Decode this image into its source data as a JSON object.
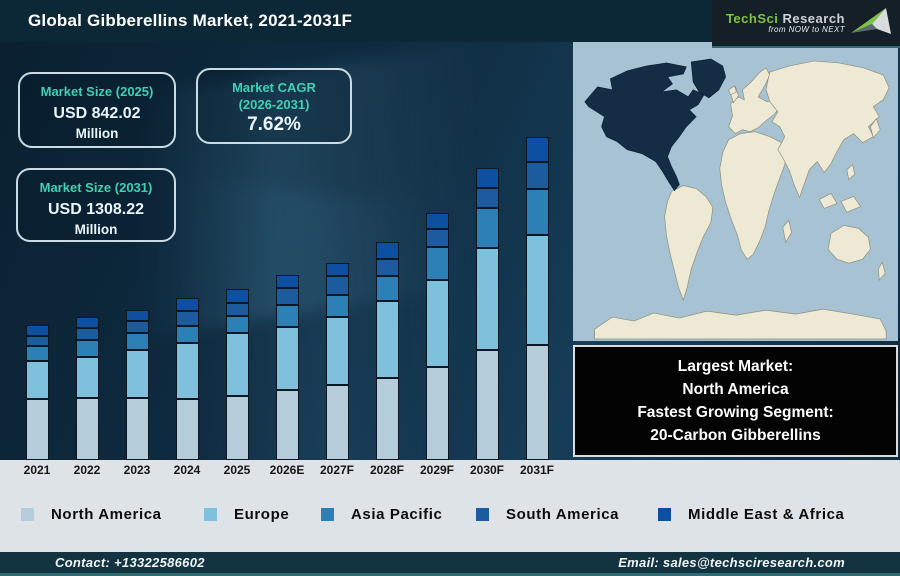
{
  "header": {
    "title": "Global Gibberellins Market, 2021-2031F",
    "logo": {
      "brand_primary": "TechSci",
      "brand_secondary": "Research",
      "tagline": "from NOW to NEXT"
    }
  },
  "stats": {
    "size_2025": {
      "label": "Market Size (2025)",
      "value": "USD 842.02",
      "unit": "Million"
    },
    "cagr": {
      "label_line1": "Market CAGR",
      "label_line2": "(2026-2031)",
      "value": "7.62%"
    },
    "size_2031": {
      "label": "Market Size (2031)",
      "value": "USD 1308.22",
      "unit": "Million"
    }
  },
  "highlight_box": {
    "line1": "Largest Market:",
    "line2": "North America",
    "line3": "Fastest Growing Segment:",
    "line4": "20-Carbon Gibberellins"
  },
  "legend": {
    "items": [
      {
        "label": "North America",
        "color": "#b5cdda"
      },
      {
        "label": "Europe",
        "color": "#7fc0dd"
      },
      {
        "label": "Asia Pacific",
        "color": "#2d80b5"
      },
      {
        "label": "South America",
        "color": "#1c5c9e"
      },
      {
        "label": "Middle East & Africa",
        "color": "#0d50a2"
      }
    ]
  },
  "chart_data": {
    "type": "bar",
    "stacked": true,
    "unit": "USD Million (estimated from bar proportions)",
    "title": "Global Gibberellins Market, 2021-2031F",
    "categories": [
      "2021",
      "2022",
      "2023",
      "2024",
      "2025",
      "2026E",
      "2027F",
      "2028F",
      "2029F",
      "2030F",
      "2031F"
    ],
    "series": [
      {
        "name": "North America",
        "color": "#b5cdda",
        "values": [
          247,
          253,
          250,
          247,
          259,
          283,
          303,
          330,
          378,
          445,
          465
        ]
      },
      {
        "name": "Europe",
        "color": "#7fc0dd",
        "values": [
          155,
          165,
          195,
          225,
          256,
          256,
          276,
          310,
          351,
          411,
          445
        ]
      },
      {
        "name": "Asia Pacific",
        "color": "#2d80b5",
        "values": [
          59,
          68,
          70,
          70,
          68,
          88,
          90,
          101,
          135,
          162,
          186
        ]
      },
      {
        "name": "South America",
        "color": "#1c5c9e",
        "values": [
          40,
          47,
          47,
          62,
          51,
          68,
          76,
          68,
          74,
          81,
          110
        ]
      },
      {
        "name": "Middle East & Africa",
        "color": "#0d50a2",
        "values": [
          45,
          45,
          45,
          54,
          55,
          54,
          54,
          70,
          64,
          81,
          101
        ]
      }
    ],
    "ylim": [
      0,
      1400
    ],
    "grid": false,
    "legend_position": "bottom",
    "annotations": {
      "market_size_2025": 842.02,
      "market_size_2031": 1308.22,
      "cagr_2026_2031_pct": 7.62
    }
  },
  "map": {
    "highlighted_region": "North America"
  },
  "footer": {
    "contact": "Contact: +13322586602",
    "email": "Email: sales@techsciresearch.com"
  }
}
